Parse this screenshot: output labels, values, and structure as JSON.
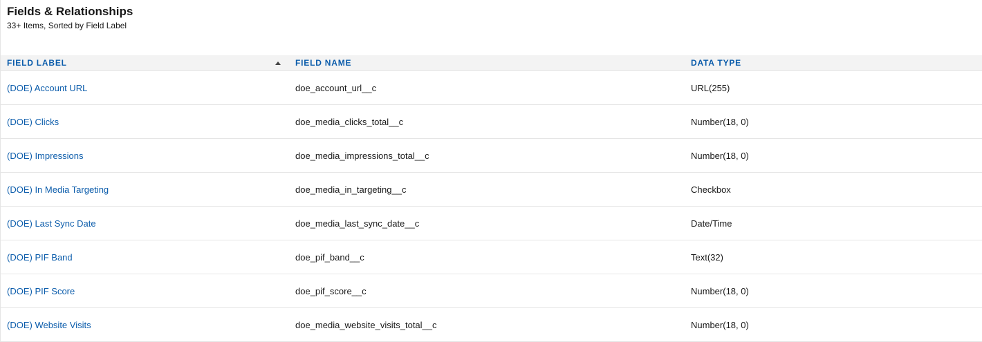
{
  "header": {
    "title": "Fields & Relationships",
    "subtitle": "33+ Items, Sorted by Field Label"
  },
  "table": {
    "columns": [
      {
        "label": "FIELD LABEL",
        "sorted": "ascending"
      },
      {
        "label": "FIELD NAME"
      },
      {
        "label": "DATA TYPE"
      }
    ],
    "rows": [
      {
        "label": "(DOE) Account URL",
        "name": "doe_account_url__c",
        "type": "URL(255)"
      },
      {
        "label": "(DOE) Clicks",
        "name": "doe_media_clicks_total__c",
        "type": "Number(18, 0)"
      },
      {
        "label": "(DOE) Impressions",
        "name": "doe_media_impressions_total__c",
        "type": "Number(18, 0)"
      },
      {
        "label": "(DOE) In Media Targeting",
        "name": "doe_media_in_targeting__c",
        "type": "Checkbox"
      },
      {
        "label": "(DOE) Last Sync Date",
        "name": "doe_media_last_sync_date__c",
        "type": "Date/Time"
      },
      {
        "label": "(DOE) PIF Band",
        "name": "doe_pif_band__c",
        "type": "Text(32)"
      },
      {
        "label": "(DOE) PIF Score",
        "name": "doe_pif_score__c",
        "type": "Number(18, 0)"
      },
      {
        "label": "(DOE) Website Visits",
        "name": "doe_media_website_visits_total__c",
        "type": "Number(18, 0)"
      }
    ]
  },
  "colors": {
    "link": "#0b5cab",
    "header_bg": "#f3f3f3",
    "divider": "#e5e5e5"
  }
}
